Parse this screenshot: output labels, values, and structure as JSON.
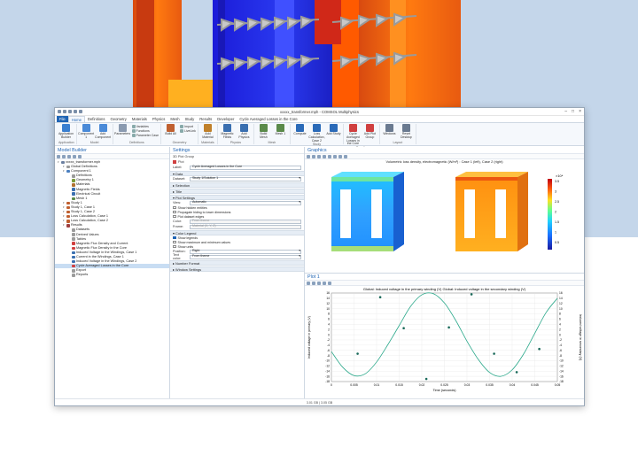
{
  "window": {
    "title": "xxxxx_transformer.mph - COMSOL Multiphysics",
    "status_text": "3.01 GB | 3.05 GB"
  },
  "ribbon": {
    "tabs": [
      "File",
      "Home",
      "Definitions",
      "Geometry",
      "Materials",
      "Physics",
      "Mesh",
      "Study",
      "Results",
      "Developer",
      "Cycle Averaged Losses in the Core"
    ],
    "groups": [
      {
        "label": "Application",
        "buttons": [
          "Application Builder"
        ]
      },
      {
        "label": "Model",
        "buttons": [
          "Component 1",
          "Add Component"
        ]
      },
      {
        "label": "Definitions",
        "buttons": [
          "Parameters"
        ],
        "small": [
          "Variables",
          "Functions",
          "Parameter Case"
        ]
      },
      {
        "label": "Geometry",
        "buttons": [
          "Build All"
        ],
        "small": [
          "Import",
          "LiveLink"
        ]
      },
      {
        "label": "Materials",
        "buttons": [
          "Add Material"
        ]
      },
      {
        "label": "Physics",
        "buttons": [
          "Magnetic Fields",
          "Add Physics"
        ]
      },
      {
        "label": "Mesh",
        "buttons": [
          "Build Mesh",
          "Mesh 1"
        ]
      },
      {
        "label": "Study",
        "buttons": [
          "Compute",
          "Loss Calculation, Case 2",
          "Add Study"
        ]
      },
      {
        "label": "Results",
        "buttons": [
          "Cycle Averaged Losses in the Core",
          "Add Plot Group"
        ]
      },
      {
        "label": "Layout",
        "buttons": [
          "Windows",
          "Reset Desktop"
        ]
      }
    ]
  },
  "model_builder": {
    "title": "Model Builder",
    "items": [
      {
        "label": "xxxxx_transformer.mph",
        "indent": 0,
        "color": "#6b7fa0"
      },
      {
        "label": "Global Definitions",
        "indent": 1,
        "color": "#9b9b9b"
      },
      {
        "label": "Component 1",
        "indent": 1,
        "color": "#4a7fc0"
      },
      {
        "label": "Definitions",
        "indent": 2,
        "color": "#9b9b9b"
      },
      {
        "label": "Geometry 1",
        "indent": 2,
        "color": "#7a9a3a"
      },
      {
        "label": "Materials",
        "indent": 2,
        "color": "#b07030"
      },
      {
        "label": "Magnetic Fields",
        "indent": 2,
        "color": "#3a6fb0"
      },
      {
        "label": "Electrical Circuit",
        "indent": 2,
        "color": "#3a6fb0"
      },
      {
        "label": "Mesh 1",
        "indent": 2,
        "color": "#5a8a4a"
      },
      {
        "label": "Study 1",
        "indent": 1,
        "color": "#c06030"
      },
      {
        "label": "Study 1, Case 1",
        "indent": 1,
        "color": "#c06030"
      },
      {
        "label": "Study 1, Case 2",
        "indent": 1,
        "color": "#c06030"
      },
      {
        "label": "Loss Calculation, Case 1",
        "indent": 1,
        "color": "#c06030"
      },
      {
        "label": "Loss Calculation, Case 2",
        "indent": 1,
        "color": "#c06030"
      },
      {
        "label": "Results",
        "indent": 1,
        "color": "#a04040"
      },
      {
        "label": "Datasets",
        "indent": 2,
        "color": "#9b9b9b"
      },
      {
        "label": "Derived Values",
        "indent": 2,
        "color": "#9b9b9b"
      },
      {
        "label": "Tables",
        "indent": 2,
        "color": "#9b9b9b"
      },
      {
        "label": "Magnetic Flux Density and Current",
        "indent": 2,
        "color": "#d04040"
      },
      {
        "label": "Magnetic Flux Density in the Core",
        "indent": 2,
        "color": "#d04040"
      },
      {
        "label": "Induced Voltage in the Windings, Case 1",
        "indent": 2,
        "color": "#3a6fb0"
      },
      {
        "label": "Current in the Windings, Case 1",
        "indent": 2,
        "color": "#3a6fb0"
      },
      {
        "label": "Induced Voltage in the Windings, Case 2",
        "indent": 2,
        "color": "#3a6fb0"
      },
      {
        "label": "Cycle Averaged Losses in the Core",
        "indent": 2,
        "color": "#d04040",
        "selected": true
      },
      {
        "label": "Export",
        "indent": 2,
        "color": "#9b9b9b"
      },
      {
        "label": "Reports",
        "indent": 2,
        "color": "#9b9b9b"
      }
    ]
  },
  "settings": {
    "title": "Settings",
    "subtitle": "3D Plot Group",
    "plot_label": "Plot",
    "label_field": "Label:",
    "label_value": "Cycle Averaged Losses in the Core",
    "data_section": "Data",
    "dataset_label": "Dataset:",
    "dataset_value": "Study 1/Solution 1",
    "selection_section": "Selection",
    "title_section": "Title",
    "plot_settings_section": "Plot Settings",
    "view_label": "View:",
    "view_value": "Automatic",
    "checks": [
      "Show hidden entities",
      "Propagate hiding to lower dimensions",
      "Plot dataset edges"
    ],
    "color_label": "Color:",
    "color_value": "From theme",
    "frame_label": "Frame:",
    "frame_value": "Material  (X, Y, Z)",
    "color_legend_section": "Color Legend",
    "legend_checks": [
      {
        "label": "Show legends",
        "on": true
      },
      {
        "label": "Show maximum and minimum values",
        "on": false
      },
      {
        "label": "Show units",
        "on": false
      }
    ],
    "position_label": "Position:",
    "position_value": "Right",
    "text_color_label": "Text color:",
    "text_color_value": "From theme",
    "number_format_section": "Number Format",
    "window_settings_section": "Window Settings"
  },
  "graphics": {
    "title": "Graphics",
    "caption": "Volumetric loss density, electromagnetic (W/m³) : Case 1 (left), Case 2 (right)",
    "colorbar_unit": "×10⁴",
    "colorbar_ticks": [
      "3.5",
      "3",
      "2.5",
      "2",
      "1.5",
      "1",
      "0.5"
    ]
  },
  "plot": {
    "title": "Plot 1",
    "caption": "Global: Induced voltage in the primary winding (V) Global: Induced voltage in the secondary winding (V)"
  },
  "chart_data": {
    "type": "line",
    "title": "Global: Induced voltage in the primary winding (V) Global: Induced voltage in the secondary winding (V)",
    "xlabel": "Time (seconds)",
    "ylabel": "Induced voltage in primary (V)",
    "y2label": "Induced voltage in secondary (V)",
    "xlim": [
      0,
      0.05
    ],
    "ylim": [
      -18,
      16
    ],
    "x_ticks": [
      "0",
      "0.005",
      "0.01",
      "0.015",
      "0.02",
      "0.025",
      "0.03",
      "0.035",
      "0.04",
      "0.045",
      "0.05"
    ],
    "y_ticks": [
      "16",
      "14",
      "12",
      "10",
      "8",
      "6",
      "4",
      "2",
      "0",
      "-2",
      "-4",
      "-6",
      "-8",
      "-10",
      "-12",
      "-14",
      "-16",
      "-18"
    ],
    "series": [
      {
        "name": "",
        "x": [
          0,
          0.0025,
          0.005,
          0.0075,
          0.01,
          0.0125,
          0.015,
          0.0175,
          0.02,
          0.0225,
          0.025,
          0.0275,
          0.03,
          0.0325,
          0.035,
          0.0375,
          0.04,
          0.0425,
          0.045,
          0.0475,
          0.05
        ],
        "values": [
          -6.5,
          -12.5,
          -15.7,
          -15,
          -10.5,
          -3.8,
          3.5,
          10.8,
          15.3,
          15.8,
          12.2,
          5.5,
          -2.5,
          -9.5,
          -14.5,
          -16,
          -13.5,
          -7.5,
          0.5,
          8.5,
          14
        ]
      },
      {
        "name": "",
        "marker": "dot",
        "x": [
          0.0058,
          0.0108,
          0.016,
          0.021,
          0.026,
          0.031,
          0.036,
          0.041,
          0.046
        ],
        "values": [
          -7.3,
          14.4,
          2.5,
          -17,
          2.8,
          15.5,
          -7.3,
          -14.4,
          -5.5
        ]
      }
    ]
  }
}
